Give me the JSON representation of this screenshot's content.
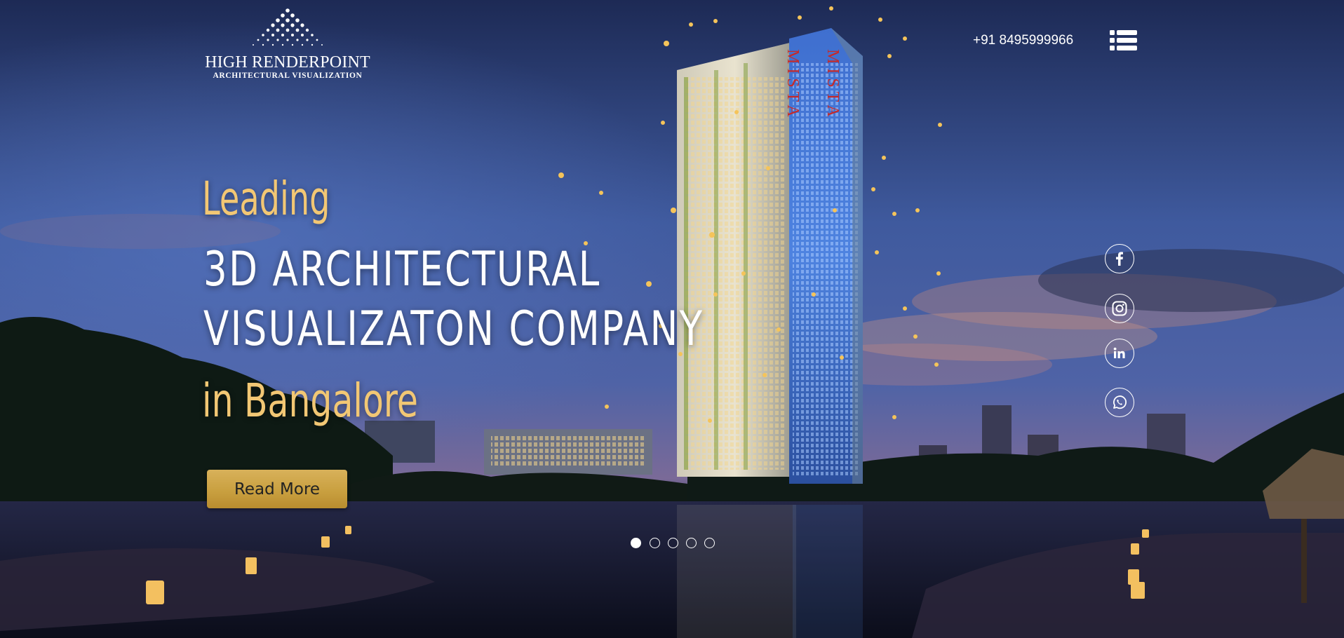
{
  "brand": {
    "name": "HIGH RENDERPOINT",
    "tagline": "ARCHITECTURAL VISUALIZATION"
  },
  "header": {
    "phone": "+91 8495999966",
    "menu_icon": "list-menu-icon"
  },
  "hero": {
    "line1": "Leading",
    "line2": "3D ARCHITECTURAL",
    "line3": "VISUALIZATON COMPANY",
    "line4": "in Bangalore",
    "cta_label": "Read More",
    "building_sign": "MISTA"
  },
  "social": [
    {
      "name": "facebook",
      "icon": "facebook-icon"
    },
    {
      "name": "instagram",
      "icon": "instagram-icon"
    },
    {
      "name": "linkedin",
      "icon": "linkedin-icon"
    },
    {
      "name": "whatsapp",
      "icon": "whatsapp-icon"
    }
  ],
  "slider": {
    "slide_count": 5,
    "active_index": 0
  },
  "colors": {
    "accent_gold": "#f2c774",
    "button_gold": "#c9a040",
    "sky_top": "#1c2a52",
    "text_white": "#ffffff"
  }
}
